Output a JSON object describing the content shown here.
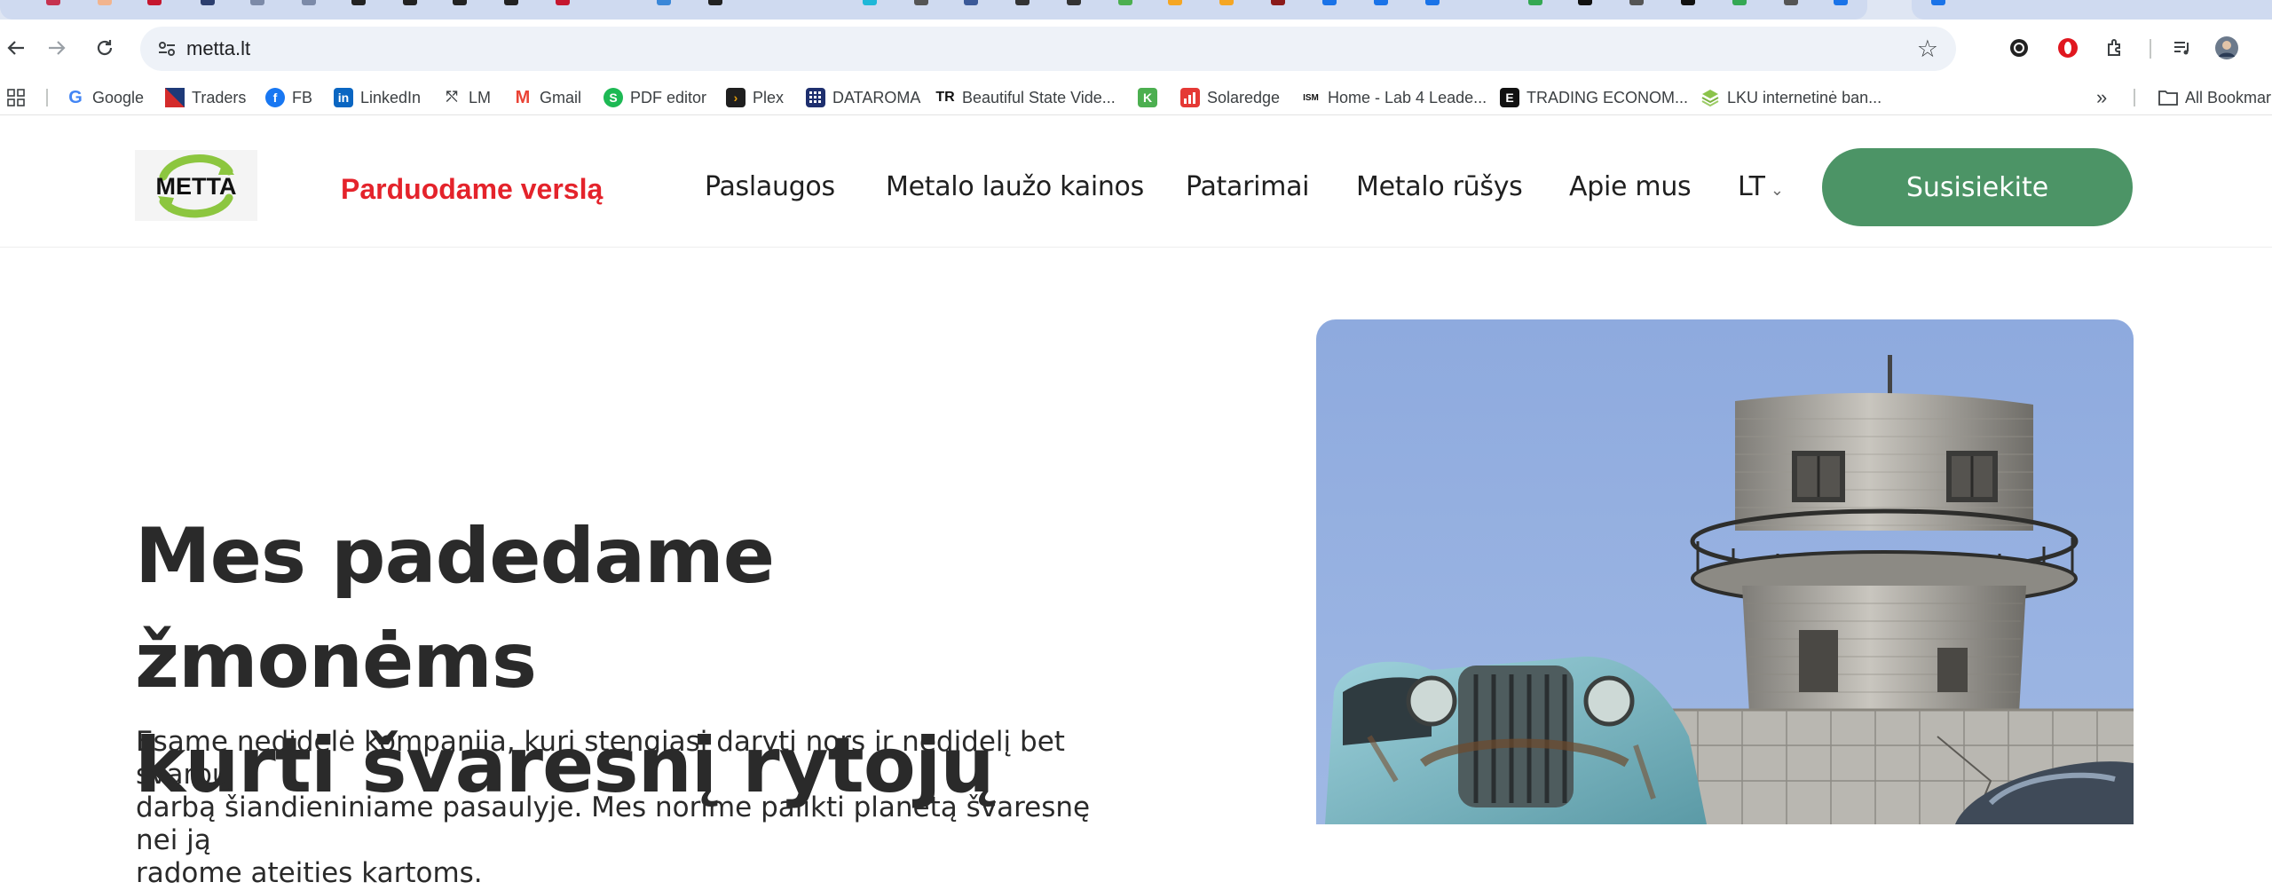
{
  "browser": {
    "url": "metta.lt",
    "bookmarks": [
      {
        "label": "Google",
        "icon": "google-icon"
      },
      {
        "label": "Traders",
        "icon": "traders-icon"
      },
      {
        "label": "FB",
        "icon": "facebook-icon"
      },
      {
        "label": "LinkedIn",
        "icon": "linkedin-icon"
      },
      {
        "label": "LM",
        "icon": "lm-icon"
      },
      {
        "label": "Gmail",
        "icon": "gmail-icon"
      },
      {
        "label": "PDF editor",
        "icon": "pdf-editor-icon"
      },
      {
        "label": "Plex",
        "icon": "plex-icon"
      },
      {
        "label": "DATAROMA",
        "icon": "dataroma-icon"
      },
      {
        "label": "Beautiful State Vide...",
        "icon": "tr-icon"
      },
      {
        "label": "",
        "icon": "k-icon"
      },
      {
        "label": "Solaredge",
        "icon": "solaredge-icon"
      },
      {
        "label": "Home - Lab 4 Leade...",
        "icon": "ism-icon"
      },
      {
        "label": "TRADING ECONOM...",
        "icon": "trading-economics-icon"
      },
      {
        "label": "LKU internetinė ban...",
        "icon": "lku-icon"
      }
    ],
    "overflow": "»",
    "all_bookmarks": "All Bookmar"
  },
  "site": {
    "logo_text": "METTA",
    "banner": "Parduodame verslą",
    "nav": [
      "Paslaugos",
      "Metalo laužo kainos",
      "Patarimai",
      "Metalo rūšys",
      "Apie mus"
    ],
    "language": "LT",
    "contact_button": "Susisiekite"
  },
  "hero": {
    "title_line1": "Mes padedame žmonėms",
    "title_line2": "kurti švaresnį rytojų",
    "text_line1": "Esame nedidelė kompanija, kuri stengiasi daryti nors ir nedidelį bet svarbų",
    "text_line2": "darbą šiandieniniame pasaulyje. Mes norime palikti planetą švaresnę nei ją",
    "text_line3": "radome ateities kartoms."
  },
  "colors": {
    "accent_green": "#4c9466",
    "banner_red": "#e4232b",
    "logo_green": "#8cc63f"
  }
}
